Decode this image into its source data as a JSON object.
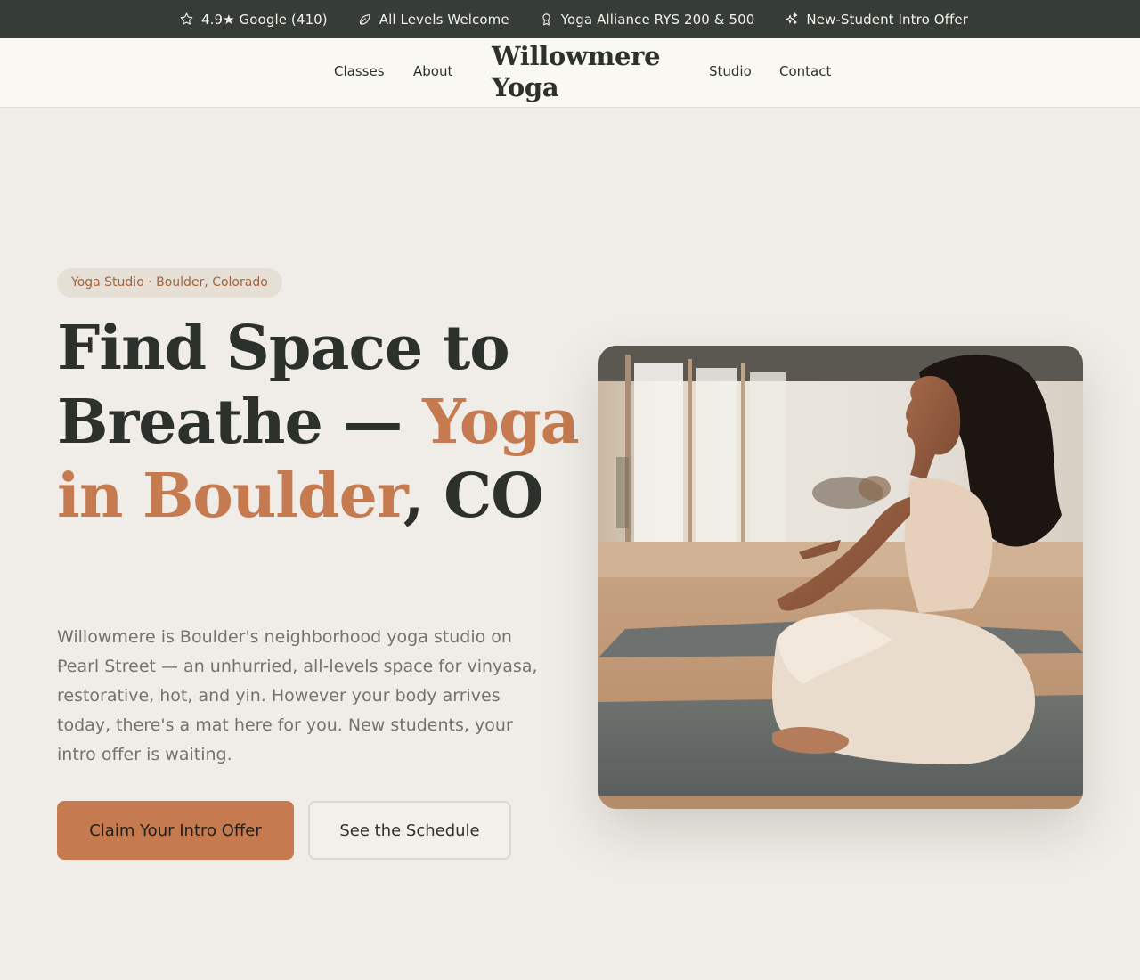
{
  "topbar": {
    "items": [
      {
        "icon": "star-icon",
        "text": "4.9★ Google (410)"
      },
      {
        "icon": "leaf-icon",
        "text": "All Levels Welcome"
      },
      {
        "icon": "award-icon",
        "text": "Yoga Alliance RYS 200 & 500"
      },
      {
        "icon": "sparkles-icon",
        "text": "New-Student Intro Offer"
      }
    ]
  },
  "header": {
    "logo": "Willowmere Yoga",
    "nav": [
      "Classes",
      "About",
      "Studio",
      "Contact"
    ]
  },
  "hero": {
    "eyebrow": "Yoga Studio · Boulder, Colorado",
    "headline_part1": "Find Space to Breathe — ",
    "headline_accent": "Yoga in Boulder",
    "headline_part2": ", CO",
    "lede": "Willowmere is Boulder's neighborhood yoga studio on Pearl Street — an unhurried, all-levels space for vinyasa, restorative, hot, and yin. However your body arrives today, there's a mat here for you. New students, your intro offer is waiting.",
    "primary_cta": "Claim Your Intro Offer",
    "secondary_cta": "See the Schedule",
    "image": "woman meditating cross-legged on a yoga mat in a bright studio"
  },
  "colors": {
    "topbar_bg": "#363c36",
    "accent": "#c57a4f",
    "text_dark": "#2d312c",
    "page_bg": "#f0ede8"
  }
}
